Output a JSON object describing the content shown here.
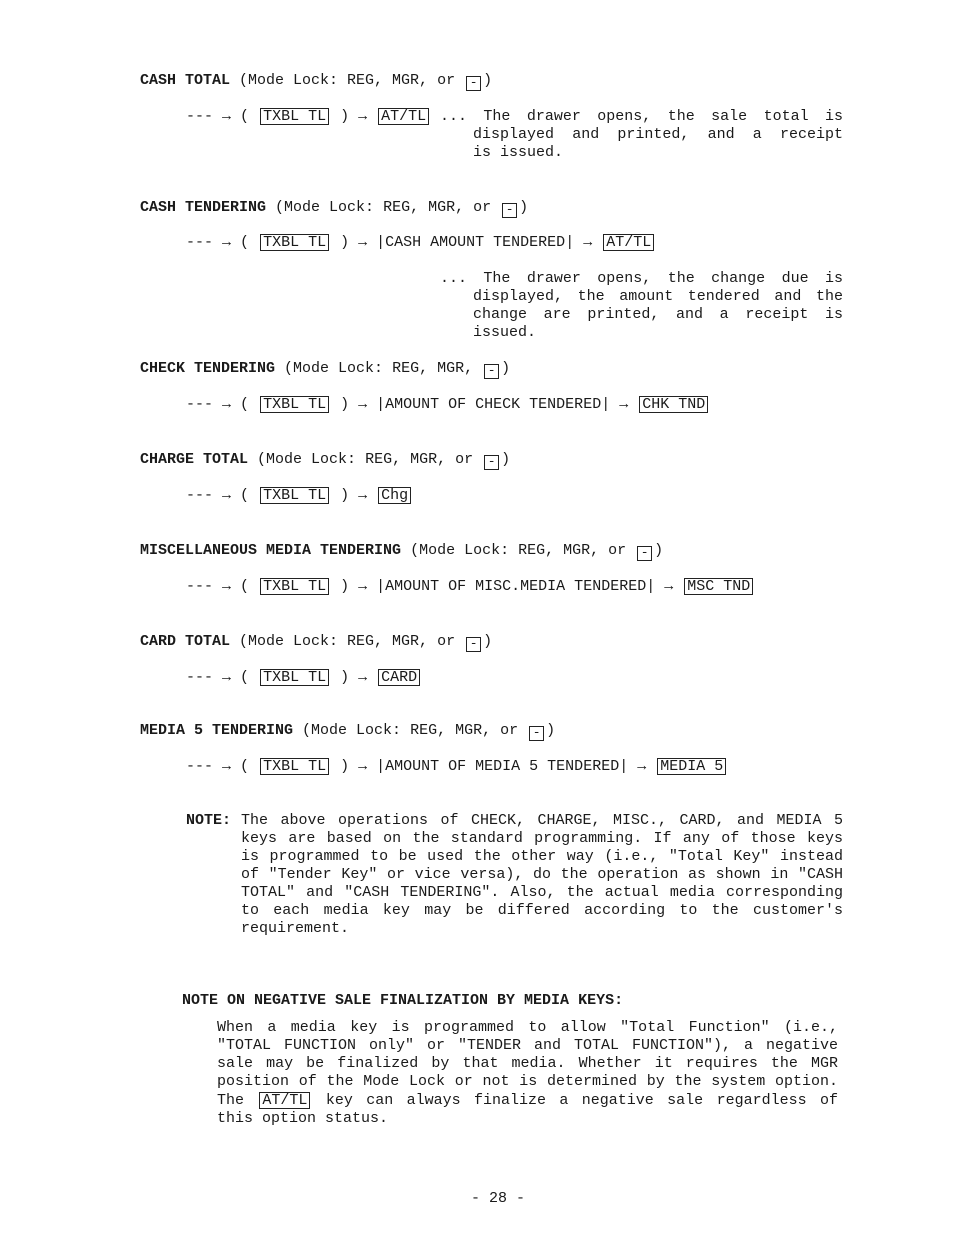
{
  "common": {
    "lead": "--- →",
    "arrow": "→",
    "open": "(",
    "close": ")",
    "minus_key": "-",
    "txbl_key": "TXBL TL"
  },
  "cash_total": {
    "title": "CASH TOTAL",
    "mode": "(Mode Lock: REG, MGR, or",
    "key": "AT/TL",
    "description": [
      "... The drawer opens, the sale total is",
      "displayed and printed, and a receipt",
      "is issued."
    ]
  },
  "cash_tendering": {
    "title": "CASH TENDERING",
    "mode": "(Mode Lock: REG, MGR, or",
    "amount": "CASH AMOUNT TENDERED",
    "key": "AT/TL",
    "description": [
      "... The drawer opens, the change due is",
      "displayed, the amount tendered and the",
      "change are printed, and a receipt is",
      "issued."
    ]
  },
  "check_tendering": {
    "title": "CHECK TENDERING",
    "mode": "(Mode Lock: REG, MGR,",
    "amount": "AMOUNT OF CHECK TENDERED",
    "key": "CHK TND"
  },
  "charge_total": {
    "title": "CHARGE TOTAL",
    "mode": "(Mode Lock: REG, MGR, or",
    "key": "Chg"
  },
  "misc_tendering": {
    "title": "MISCELLANEOUS MEDIA TENDERING",
    "mode": "(Mode Lock: REG, MGR, or",
    "amount": "AMOUNT OF MISC.MEDIA TENDERED",
    "key": "MSC TND"
  },
  "card_total": {
    "title": "CARD TOTAL",
    "mode": "(Mode Lock: REG, MGR, or",
    "key": "CARD"
  },
  "media5_tendering": {
    "title": "MEDIA 5 TENDERING",
    "mode": "(Mode Lock: REG, MGR, or",
    "amount": "AMOUNT OF MEDIA 5 TENDERED",
    "key": "MEDIA 5"
  },
  "note": {
    "label": "NOTE:",
    "lines": [
      "The above operations of CHECK, CHARGE, MISC., CARD, and MEDIA 5",
      "keys are based on the standard programming.  If any of those keys",
      "is programmed to be used the other way (i.e., \"Total Key\" instead",
      "of \"Tender Key\" or vice versa), do the operation as shown in \"CASH",
      "TOTAL\" and \"CASH TENDERING\".  Also, the actual media corresponding",
      "to each media key may be differed according to the customer's",
      "requirement."
    ]
  },
  "negative": {
    "title": "NOTE ON NEGATIVE SALE FINALIZATION BY MEDIA KEYS:",
    "lines": [
      "When a media key is programmed to allow \"Total Function\" (i.e.,",
      "\"TOTAL FUNCTION only\" or \"TENDER and TOTAL FUNCTION\"), a negative",
      "sale may be finalized by that media.  Whether it requires the MGR",
      "position of the Mode Lock or not is determined by the system option."
    ],
    "last_pre": "The",
    "last_key": "AT/TL",
    "last_post": "key can always finalize a negative sale regardless of",
    "final": "this option status."
  },
  "footer": {
    "page": "- 28 -"
  }
}
